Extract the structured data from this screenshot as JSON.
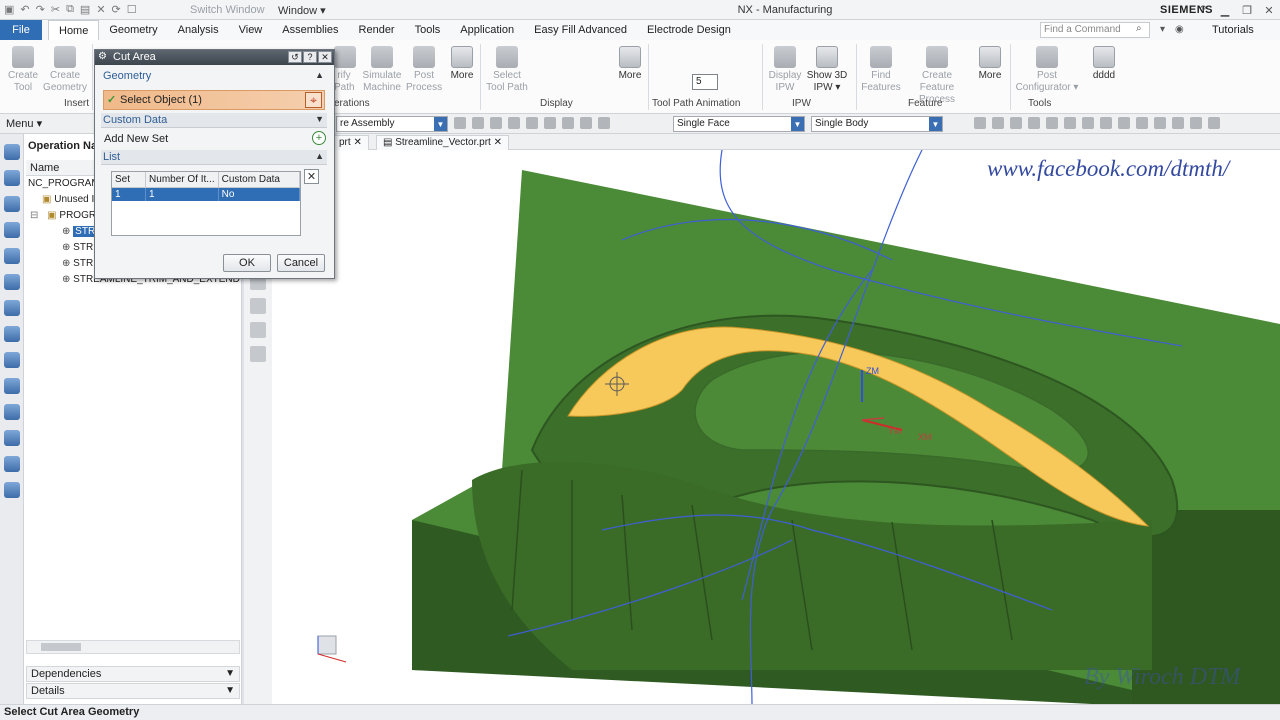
{
  "titlebar": {
    "switch_window": "Switch Window",
    "window_menu": "Window ▾",
    "app_title": "NX - Manufacturing",
    "brand": "SIEMENS"
  },
  "menubar": {
    "file": "File",
    "tabs": [
      "Home",
      "Geometry",
      "Analysis",
      "View",
      "Assemblies",
      "Render",
      "Tools",
      "Application",
      "Easy Fill Advanced",
      "Electrode Design"
    ],
    "find_placeholder": "Find a Command",
    "tutorials": "Tutorials"
  },
  "ribbon": {
    "create_tool": [
      "Create",
      "Tool"
    ],
    "create_geometry": [
      "Create",
      "Geometry"
    ],
    "insert_label": "Insert",
    "verify_path": [
      "rify",
      "Path"
    ],
    "simulate_machine": [
      "Simulate",
      "Machine"
    ],
    "post_process": [
      "Post",
      "Process"
    ],
    "more": "More",
    "operations_label": "erations",
    "select_tool_path": [
      "Select",
      "Tool Path"
    ],
    "display_label": "Display",
    "animation_step": "5",
    "tool_path_animation_label": "Tool Path Animation",
    "display_ipw": [
      "Display",
      "IPW"
    ],
    "show_3d_ipw": [
      "Show 3D",
      "IPW ▾"
    ],
    "ipw_label": "IPW",
    "find_features": [
      "Find",
      "Features"
    ],
    "create_feature_process": [
      "Create Feature",
      "Process"
    ],
    "feature_label": "Feature",
    "post_configurator": [
      "Post",
      "Configurator ▾"
    ],
    "tools_label": "Tools",
    "dddd": "dddd"
  },
  "toolbar2": {
    "menu": "Menu ▾",
    "assembly_filter": "re Assembly",
    "face_rule": "Single Face",
    "body_rule": "Single Body"
  },
  "navigator": {
    "title": "Operation Nav",
    "column": "Name",
    "rows": [
      {
        "label": "NC_PROGRAM"
      },
      {
        "label": "Unused It"
      },
      {
        "label": "PROGR"
      },
      {
        "label": "STR"
      },
      {
        "label": "STR"
      },
      {
        "label": "STR"
      },
      {
        "label": "STREAMLINE_TRIM_AND_EXTEND"
      }
    ],
    "dependencies": "Dependencies",
    "details": "Details"
  },
  "viewport": {
    "tab1": "prt",
    "tab2": "Streamline_Vector.prt",
    "facebook": "www.facebook.com/dtmth/",
    "watermark": "By Wiroch DTM",
    "axis_labels": {
      "zc": "ZM",
      "yc": "YM",
      "xc": "XM"
    }
  },
  "dialog": {
    "title": "Cut Area",
    "geometry": "Geometry",
    "select_object": "Select Object (1)",
    "custom_data": "Custom Data",
    "add_new_set": "Add New Set",
    "list": "List",
    "columns": [
      "Set",
      "Number Of It...",
      "Custom Data"
    ],
    "row": [
      "1",
      "1",
      "No"
    ],
    "ok": "OK",
    "cancel": "Cancel"
  },
  "status": "Select Cut Area Geometry",
  "colors": {
    "mold_green": "#3f7a2e",
    "highlight_face": "#f7c95a",
    "accent_blue": "#2f6db5"
  }
}
